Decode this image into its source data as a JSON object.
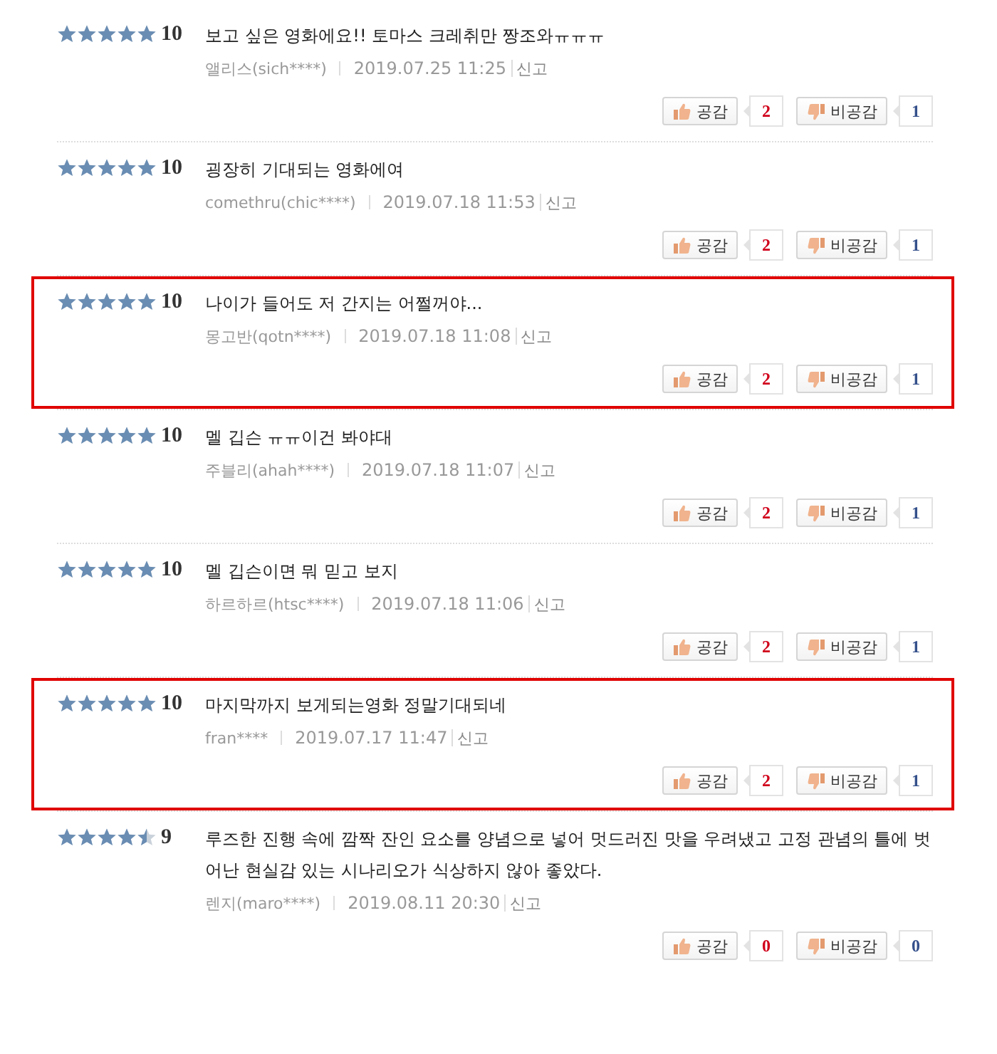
{
  "reviews": [
    {
      "stars": 5,
      "score": "10",
      "text": "보고 싶은 영화에요!! 토마스 크레취만 짱조와ㅠㅠㅠ",
      "author": "앨리스(sich****)",
      "date": "2019.07.25 11:25",
      "report": "신고",
      "like_label": "공감",
      "like_count": "2",
      "dislike_label": "비공감",
      "dislike_count": "1",
      "highlighted": false
    },
    {
      "stars": 5,
      "score": "10",
      "text": "굉장히 기대되는 영화에여",
      "author": "comethru(chic****)",
      "date": "2019.07.18 11:53",
      "report": "신고",
      "like_label": "공감",
      "like_count": "2",
      "dislike_label": "비공감",
      "dislike_count": "1",
      "highlighted": false
    },
    {
      "stars": 5,
      "score": "10",
      "text": "나이가 들어도 저 간지는 어쩔꺼야...",
      "author": "몽고반(qotn****)",
      "date": "2019.07.18 11:08",
      "report": "신고",
      "like_label": "공감",
      "like_count": "2",
      "dislike_label": "비공감",
      "dislike_count": "1",
      "highlighted": true
    },
    {
      "stars": 5,
      "score": "10",
      "text": "멜 깁슨 ㅠㅠ이건 봐야대",
      "author": "주블리(ahah****)",
      "date": "2019.07.18 11:07",
      "report": "신고",
      "like_label": "공감",
      "like_count": "2",
      "dislike_label": "비공감",
      "dislike_count": "1",
      "highlighted": false
    },
    {
      "stars": 5,
      "score": "10",
      "text": "멜 깁슨이면 뭐 믿고 보지",
      "author": "하르하르(htsc****)",
      "date": "2019.07.18 11:06",
      "report": "신고",
      "like_label": "공감",
      "like_count": "2",
      "dislike_label": "비공감",
      "dislike_count": "1",
      "highlighted": false
    },
    {
      "stars": 5,
      "score": "10",
      "text": "마지막까지 보게되는영화 정말기대되네",
      "author": "fran****",
      "date": "2019.07.17 11:47",
      "report": "신고",
      "like_label": "공감",
      "like_count": "2",
      "dislike_label": "비공감",
      "dislike_count": "1",
      "highlighted": true
    },
    {
      "stars": 4.5,
      "score": "9",
      "text": "루즈한 진행 속에 깜짝 잔인 요소를 양념으로 넣어 멋드러진 맛을 우려냈고 고정 관념의 틀에 벗어난 현실감 있는 시나리오가 식상하지 않아 좋았다.",
      "author": "렌지(maro****)",
      "date": "2019.08.11 20:30",
      "report": "신고",
      "like_label": "공감",
      "like_count": "0",
      "dislike_label": "비공감",
      "dislike_count": "0",
      "highlighted": false
    }
  ]
}
